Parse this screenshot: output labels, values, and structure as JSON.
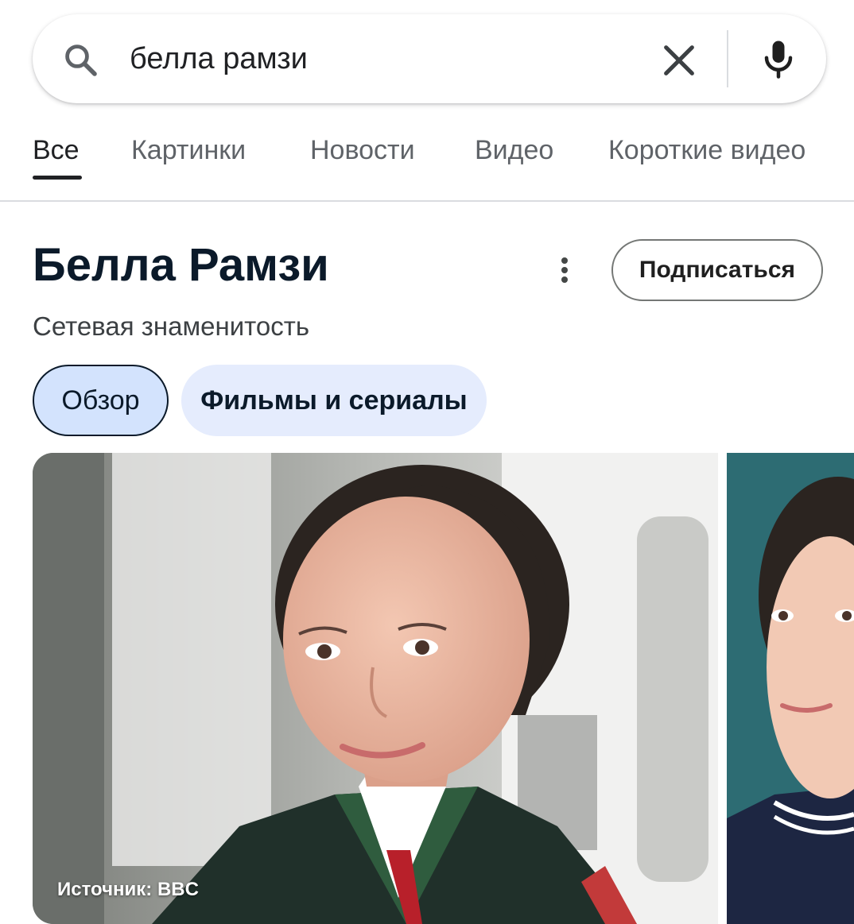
{
  "search": {
    "query": "белла рамзи"
  },
  "tabs": [
    {
      "label": "Все",
      "active": true
    },
    {
      "label": "Картинки",
      "active": false
    },
    {
      "label": "Новости",
      "active": false
    },
    {
      "label": "Видео",
      "active": false
    },
    {
      "label": "Короткие видео",
      "active": false
    }
  ],
  "panel": {
    "title": "Белла Рамзи",
    "subtitle": "Сетевая знаменитость",
    "subscribe_label": "Подписаться",
    "chips": [
      {
        "label": "Обзор",
        "selected": true
      },
      {
        "label": "Фильмы и сериалы",
        "selected": false
      }
    ],
    "image_source": "Источник: BBC"
  },
  "icons": {
    "search": "search-icon",
    "clear": "close-icon",
    "mic": "microphone-icon",
    "more": "more-vertical-icon"
  },
  "colors": {
    "accent_chip": "#d3e3fd",
    "chip_light": "#e5ecfd",
    "text_dark": "#0b1a2a",
    "tab_inactive": "#5f6368"
  }
}
